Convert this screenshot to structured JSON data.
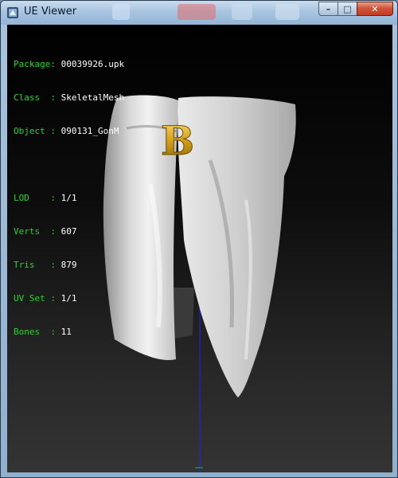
{
  "window": {
    "title": "UE Viewer",
    "buttons": {
      "minimize": "–",
      "maximize": "□",
      "close": "✕"
    }
  },
  "info": {
    "object_lines": [
      {
        "key": "Package",
        "sep": ": ",
        "value": "00039926.upk"
      },
      {
        "key": "Class  ",
        "sep": ": ",
        "value": "SkeletalMesh"
      },
      {
        "key": "Object ",
        "sep": ": ",
        "value": "090131_GonM"
      }
    ],
    "mesh_lines": [
      {
        "key": "LOD    ",
        "sep": ": ",
        "value": "1/1"
      },
      {
        "key": "Verts  ",
        "sep": ": ",
        "value": "607"
      },
      {
        "key": "Tris   ",
        "sep": ": ",
        "value": "879"
      },
      {
        "key": "UV Set ",
        "sep": ": ",
        "value": "1/1"
      },
      {
        "key": "Bones  ",
        "sep": ": ",
        "value": "11"
      }
    ]
  },
  "model": {
    "letter": "B"
  },
  "colors": {
    "info_key": "#22d822",
    "info_value": "#ffffff",
    "emblem": "#d4a017"
  }
}
